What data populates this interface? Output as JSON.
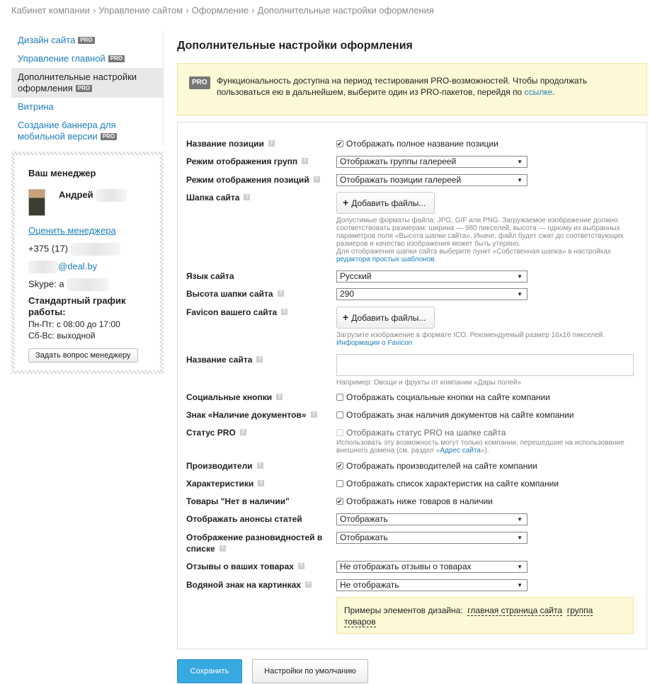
{
  "breadcrumb": [
    "Кабинет компании",
    "Управление сайтом",
    "Оформление",
    "Дополнительные настройки оформления"
  ],
  "breadcrumb_sep": "›",
  "pro_badge": "PRO",
  "sidebar": {
    "items": [
      {
        "label": "Дизайн сайта",
        "pro": true
      },
      {
        "label": "Управление главной",
        "pro": true
      },
      {
        "label": "Дополнительные настройки оформления",
        "pro": true,
        "active": true
      },
      {
        "label": "Витрина",
        "pro": false
      },
      {
        "label": "Создание баннера для мобильной версии",
        "pro": true
      }
    ]
  },
  "manager": {
    "title": "Ваш менеджер",
    "name": "Андрей",
    "rate_link": "Оценить менеджера",
    "phone": "+375 (17)",
    "email_suffix": "@deal.by",
    "skype": "Skype: a",
    "schedule_title": "Стандартный график работы:",
    "schedule_weekdays": "Пн-Пт: с 08:00 до 17:00",
    "schedule_weekend": "Сб-Вс: выходной",
    "ask_button": "Задать вопрос менеджеру"
  },
  "page_title": "Дополнительные настройки оформления",
  "notice": {
    "badge": "PRO",
    "text": "Функциональность доступна на период тестирования PRO-возможностей. Чтобы продолжать пользоваться ею в дальнейшем, выберите один из PRO-пакетов, перейдя по",
    "link": "ссылке",
    "end": "."
  },
  "help_icon": "?",
  "form": {
    "position_name": {
      "label": "Название позиции",
      "checkbox": "Отображать полное название позиции",
      "checked": true
    },
    "groups_mode": {
      "label": "Режим отображения групп",
      "value": "Отображать группы галереей"
    },
    "positions_mode": {
      "label": "Режим отображения позиций",
      "value": "Отображать позиции галереей"
    },
    "header": {
      "label": "Шапка сайта",
      "button": "Добавить файлы...",
      "hint": "Допустимые форматы файла: JPG, GIF или PNG. Загружаемое изображение должно соответствовать размерам: ширина — 980 пикселей, высота — одному из выбранных параметров поля «Высота шапки сайта». Иначе, файл будет сжат до соответствующих размеров и качество изображения может быть утеряно.",
      "hint2_prefix": "Для отображения шапки сайта выберите пункт «Собственная шапка» в настройках",
      "hint2_link": "редактора простых шаблонов",
      "hint2_end": "."
    },
    "language": {
      "label": "Язык сайта",
      "value": "Русский"
    },
    "header_height": {
      "label": "Высота шапки сайта",
      "value": "290"
    },
    "favicon": {
      "label": "Favicon вашего сайта",
      "button": "Добавить файлы...",
      "hint": "Загрузите изображение в формате ICO. Рекомендуемый размер 16х16 пикселей.",
      "hint_link": "Информация о Favicon"
    },
    "site_name": {
      "label": "Название сайта",
      "value": "",
      "hint": "Например: Овощи и фрукты от компании «Дары полей»"
    },
    "social": {
      "label": "Социальные кнопки",
      "checkbox": "Отображать социальные кнопки на сайте компании",
      "checked": false
    },
    "docs_sign": {
      "label": "Знак «Наличие документов»",
      "checkbox": "Отображать знак наличия документов на сайте компании",
      "checked": false
    },
    "pro_status": {
      "label": "Статус PRO",
      "checkbox": "Отображать статус PRO на шапке сайта",
      "checked": false,
      "hint": "Использовать эту возможность могут только компании, перешедшие на использование внешнего домена (см. раздел «",
      "hint_link": "Адрес сайта",
      "hint_end": "»)."
    },
    "manufacturers": {
      "label": "Производители",
      "checkbox": "Отображать производителей на сайте компании",
      "checked": true
    },
    "characteristics": {
      "label": "Характеристики",
      "checkbox": "Отображать список характеристик на сайте компании",
      "checked": false
    },
    "out_of_stock": {
      "label": "Товары \"Нет в наличии\"",
      "checkbox": "Отображать ниже товаров в наличии",
      "checked": true
    },
    "article_announce": {
      "label": "Отображать анонсы статей",
      "value": "Отображать"
    },
    "variants_list": {
      "label": "Отображение разновидностей в списке",
      "value": "Отображать"
    },
    "reviews": {
      "label": "Отзывы о ваших товарах",
      "value": "Не отображать отзывы о товарах"
    },
    "watermark": {
      "label": "Водяной знак на картинках",
      "value": "Не отображать"
    },
    "examples": {
      "prefix": "Примеры элементов дизайна:",
      "link1": "главная страница сайта",
      "link2": "группа товаров"
    }
  },
  "buttons": {
    "save": "Сохранить",
    "defaults": "Настройки по умолчанию"
  },
  "colors": {
    "accent": "#36a9e1",
    "link": "#1c7fbd",
    "notice_bg": "#fdf8d6"
  }
}
